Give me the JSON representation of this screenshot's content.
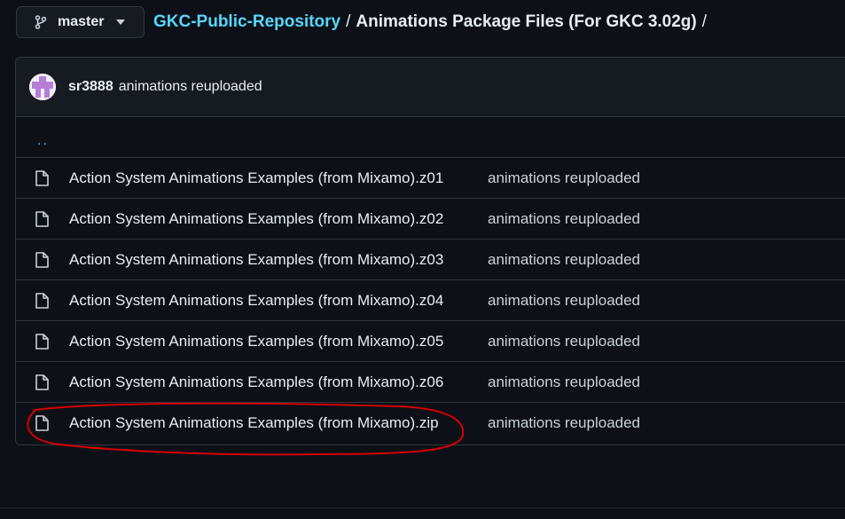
{
  "branch": {
    "label": "master",
    "icon": "git-branch-icon"
  },
  "breadcrumb": {
    "repo": "GKC-Public-Repository",
    "separator": "/",
    "folder": "Animations Package Files (For GKC 3.02g)",
    "trailing": "/"
  },
  "commit": {
    "author": "sr3888",
    "message": "animations reuploaded"
  },
  "parent_dir": "..",
  "files": [
    {
      "name": "Action System Animations Examples (from Mixamo).z01",
      "commit": "animations reuploaded"
    },
    {
      "name": "Action System Animations Examples (from Mixamo).z02",
      "commit": "animations reuploaded"
    },
    {
      "name": "Action System Animations Examples (from Mixamo).z03",
      "commit": "animations reuploaded"
    },
    {
      "name": "Action System Animations Examples (from Mixamo).z04",
      "commit": "animations reuploaded"
    },
    {
      "name": "Action System Animations Examples (from Mixamo).z05",
      "commit": "animations reuploaded"
    },
    {
      "name": "Action System Animations Examples (from Mixamo).z06",
      "commit": "animations reuploaded"
    },
    {
      "name": "Action System Animations Examples (from Mixamo).zip",
      "commit": "animations reuploaded"
    }
  ],
  "colors": {
    "background": "#0d1117",
    "link": "#58d6ff",
    "annotation": "#d40000"
  }
}
